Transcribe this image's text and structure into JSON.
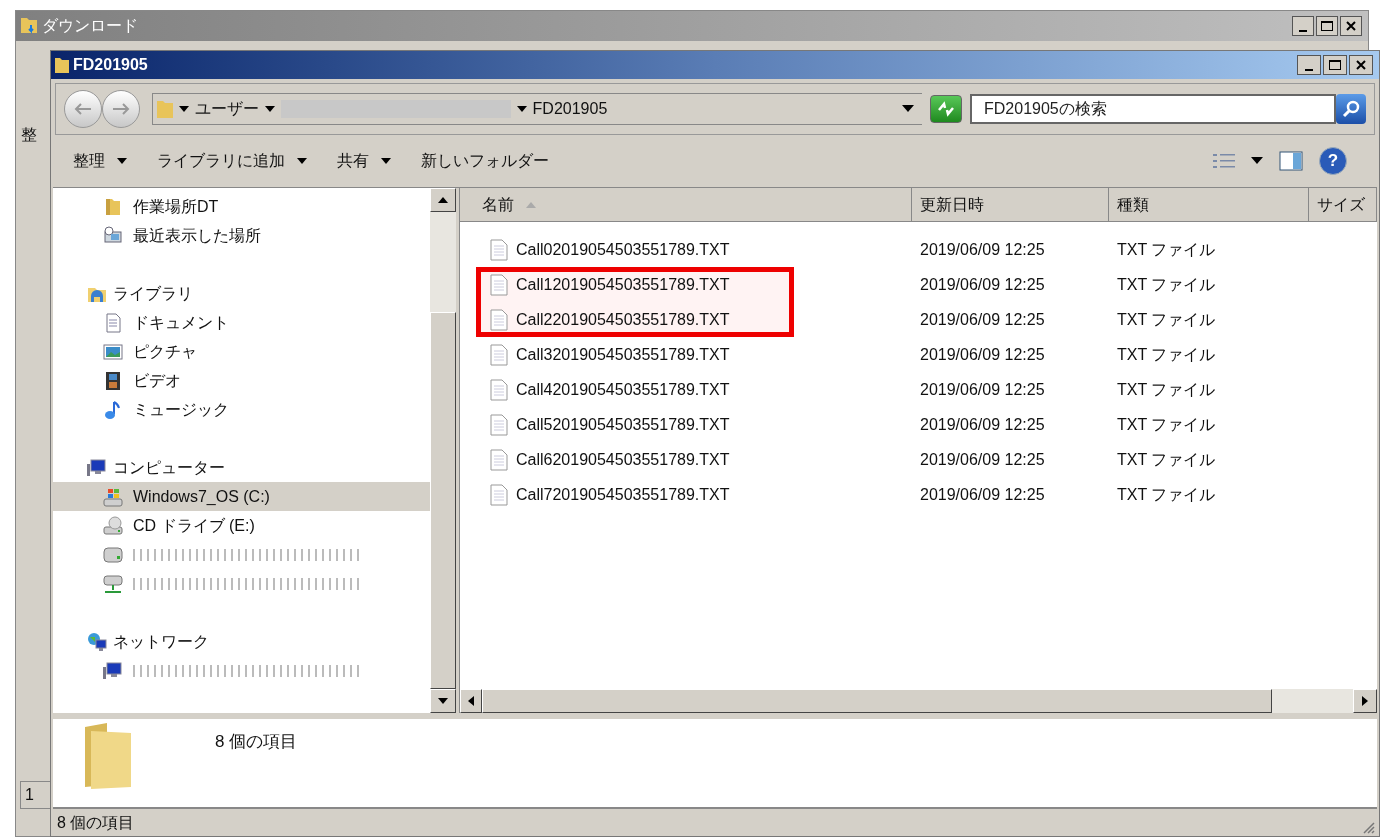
{
  "back_window": {
    "title": "ダウンロード",
    "toolbar_fragment": "整",
    "status_fragment": "1"
  },
  "window": {
    "title": "FD201905"
  },
  "address_bar": {
    "segments": [
      {
        "label": "ユーザー",
        "redacted": false
      },
      {
        "redacted": true
      },
      {
        "label": "FD201905",
        "redacted": false
      }
    ]
  },
  "search": {
    "placeholder": "FD201905の検索"
  },
  "toolbar": {
    "items": [
      {
        "label": "整理",
        "dropdown": true
      },
      {
        "label": "ライブラリに追加",
        "dropdown": true
      },
      {
        "label": "共有",
        "dropdown": true
      },
      {
        "label": "新しいフォルダー",
        "dropdown": false
      }
    ],
    "help": "?"
  },
  "sidebar": {
    "sections": [
      {
        "children": [
          {
            "label": "作業場所DT",
            "kind": "folder",
            "selected": false,
            "redacted": false
          },
          {
            "label": "最近表示した場所",
            "kind": "recent",
            "selected": false,
            "redacted": false
          }
        ]
      },
      {
        "label": "ライブラリ",
        "kind": "library",
        "children": [
          {
            "label": "ドキュメント",
            "kind": "document",
            "selected": false,
            "redacted": false
          },
          {
            "label": "ピクチャ",
            "kind": "picture",
            "selected": false,
            "redacted": false
          },
          {
            "label": "ビデオ",
            "kind": "video",
            "selected": false,
            "redacted": false
          },
          {
            "label": "ミュージック",
            "kind": "music",
            "selected": false,
            "redacted": false
          }
        ]
      },
      {
        "label": "コンピューター",
        "kind": "computer",
        "children": [
          {
            "label": "Windows7_OS (C:)",
            "kind": "os-drive",
            "selected": true,
            "redacted": false
          },
          {
            "label": "CD ドライブ (E:)",
            "kind": "cd-drive",
            "selected": false,
            "redacted": false
          },
          {
            "kind": "drive",
            "selected": false,
            "redacted": true
          },
          {
            "kind": "network-drive",
            "selected": false,
            "redacted": true
          }
        ]
      },
      {
        "label": "ネットワーク",
        "kind": "network",
        "children": [
          {
            "kind": "computer",
            "selected": false,
            "redacted": true
          }
        ]
      }
    ]
  },
  "table": {
    "columns": [
      {
        "label": "名前",
        "sorted": true
      },
      {
        "label": "更新日時",
        "sorted": false
      },
      {
        "label": "種類",
        "sorted": false
      },
      {
        "label": "サイズ",
        "sorted": false
      }
    ],
    "rows": [
      {
        "name": "Call02019054503551789.TXT",
        "modified": "2019/06/09 12:25",
        "type": "TXT ファイル",
        "marked": false
      },
      {
        "name": "Call12019054503551789.TXT",
        "modified": "2019/06/09 12:25",
        "type": "TXT ファイル",
        "marked": true
      },
      {
        "name": "Call22019054503551789.TXT",
        "modified": "2019/06/09 12:25",
        "type": "TXT ファイル",
        "marked": true
      },
      {
        "name": "Call32019054503551789.TXT",
        "modified": "2019/06/09 12:25",
        "type": "TXT ファイル",
        "marked": false
      },
      {
        "name": "Call42019054503551789.TXT",
        "modified": "2019/06/09 12:25",
        "type": "TXT ファイル",
        "marked": false
      },
      {
        "name": "Call52019054503551789.TXT",
        "modified": "2019/06/09 12:25",
        "type": "TXT ファイル",
        "marked": false
      },
      {
        "name": "Call62019054503551789.TXT",
        "modified": "2019/06/09 12:25",
        "type": "TXT ファイル",
        "marked": false
      },
      {
        "name": "Call72019054503551789.TXT",
        "modified": "2019/06/09 12:25",
        "type": "TXT ファイル",
        "marked": false
      }
    ]
  },
  "details_pane": {
    "text": "8 個の項目"
  },
  "status_bar": {
    "text": "8 個の項目"
  }
}
